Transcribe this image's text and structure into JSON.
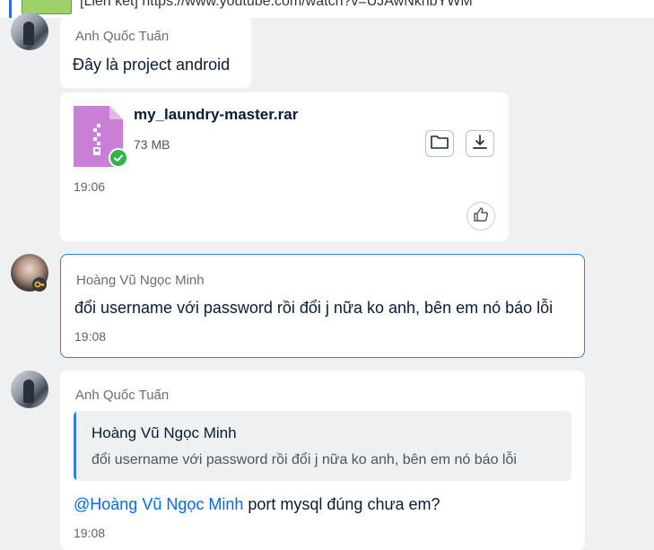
{
  "top_link": {
    "text": "[Liên kết] https://www.youtube.com/watch?v=UJAwNkhbYWM"
  },
  "messages": [
    {
      "sender": "Anh Quốc Tuấn",
      "text": "Đây là project android"
    },
    {
      "file_name": "my_laundry-master.rar",
      "file_size": "73 MB",
      "time": "19:06"
    },
    {
      "sender": "Hoàng Vũ Ngọc Minh",
      "text": "đổi username với password rồi đổi j nữa ko anh, bên em nó báo lỗi",
      "time": "19:08"
    },
    {
      "sender": "Anh Quốc Tuấn",
      "quote": {
        "sender": "Hoàng Vũ Ngọc Minh",
        "text": "đổi username với password rồi đổi j nữa ko anh, bên em nó báo lỗi"
      },
      "mention": "@Hoàng Vũ Ngọc Minh",
      "text": " port mysql đúng chưa em?",
      "time": "19:08"
    }
  ],
  "icons": {
    "file_type": "zip-file-icon",
    "file_status": "check-circle-icon",
    "open_folder": "folder-icon",
    "download": "download-icon",
    "react": "thumbs-up-icon",
    "avatar_badge": "key-icon"
  },
  "colors": {
    "accent": "#0068ff",
    "selected_border": "#2f7fe0",
    "file_icon": "#c97fd6",
    "status_ok": "#2fb34a"
  }
}
